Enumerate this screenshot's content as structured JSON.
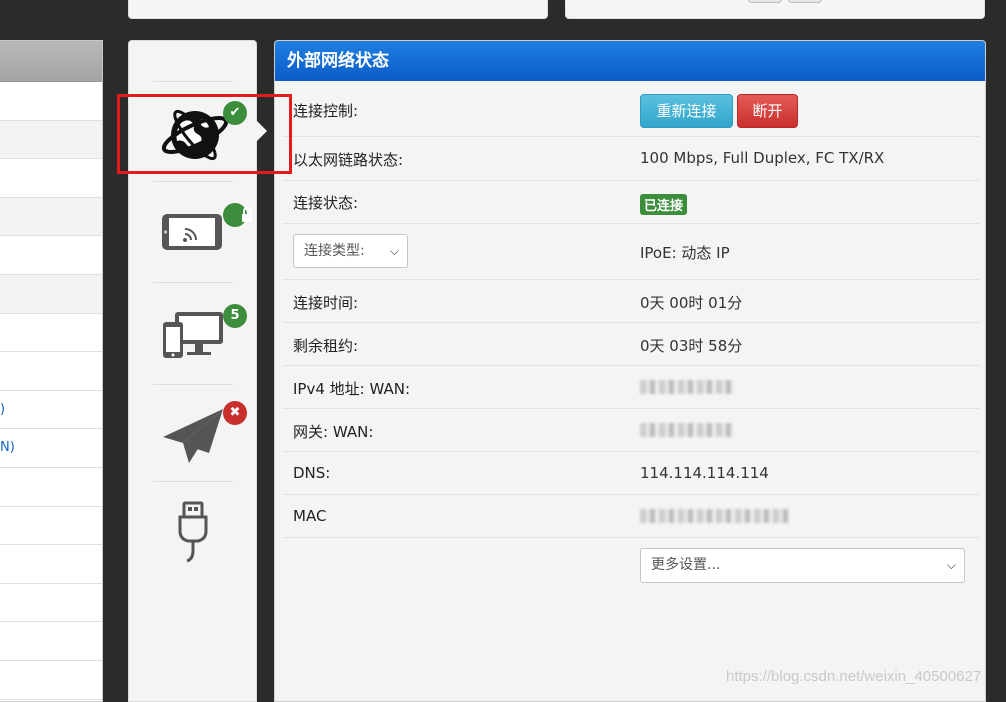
{
  "panel": {
    "title": "外部网络状态",
    "rows": {
      "control": {
        "label": "连接控制:",
        "reconnect": "重新连接",
        "disconnect": "断开"
      },
      "link": {
        "label": "以太网链路状态:",
        "value": "100 Mbps, Full Duplex, FC TX/RX"
      },
      "state": {
        "label": "连接状态:",
        "badge": "已连接"
      },
      "type": {
        "select": "连接类型:",
        "value": "IPoE: 动态 IP"
      },
      "uptime": {
        "label": "连接时间:",
        "value": "0天 00时 01分"
      },
      "lease": {
        "label": "剩余租约:",
        "value": "0天 03时 58分"
      },
      "ipv4": {
        "label": "IPv4 地址: WAN:"
      },
      "gateway": {
        "label": "网关: WAN:"
      },
      "dns": {
        "label": "DNS:",
        "value": "114.114.114.114"
      },
      "mac": {
        "label": "MAC"
      }
    },
    "more_select": "更多设置..."
  },
  "icons": [
    {
      "name": "globe-icon",
      "badge": "",
      "badge_kind": "check"
    },
    {
      "name": "wireless-tablet-icon",
      "badge": "",
      "badge_kind": "lock"
    },
    {
      "name": "devices-icon",
      "badge": "5",
      "badge_kind": "count"
    },
    {
      "name": "paper-plane-icon",
      "badge": "",
      "badge_kind": "error"
    },
    {
      "name": "usb-icon",
      "badge": "",
      "badge_kind": "none"
    }
  ],
  "sidebar": {
    "partial_labels": [
      ")",
      "N)"
    ]
  },
  "watermark": "https://blog.csdn.net/weixin_40500627",
  "colors": {
    "header_blue": "#0b5cc8",
    "badge_green": "#3c8d3c",
    "alert_red": "#c9302c",
    "info_blue": "#5bc0de"
  }
}
